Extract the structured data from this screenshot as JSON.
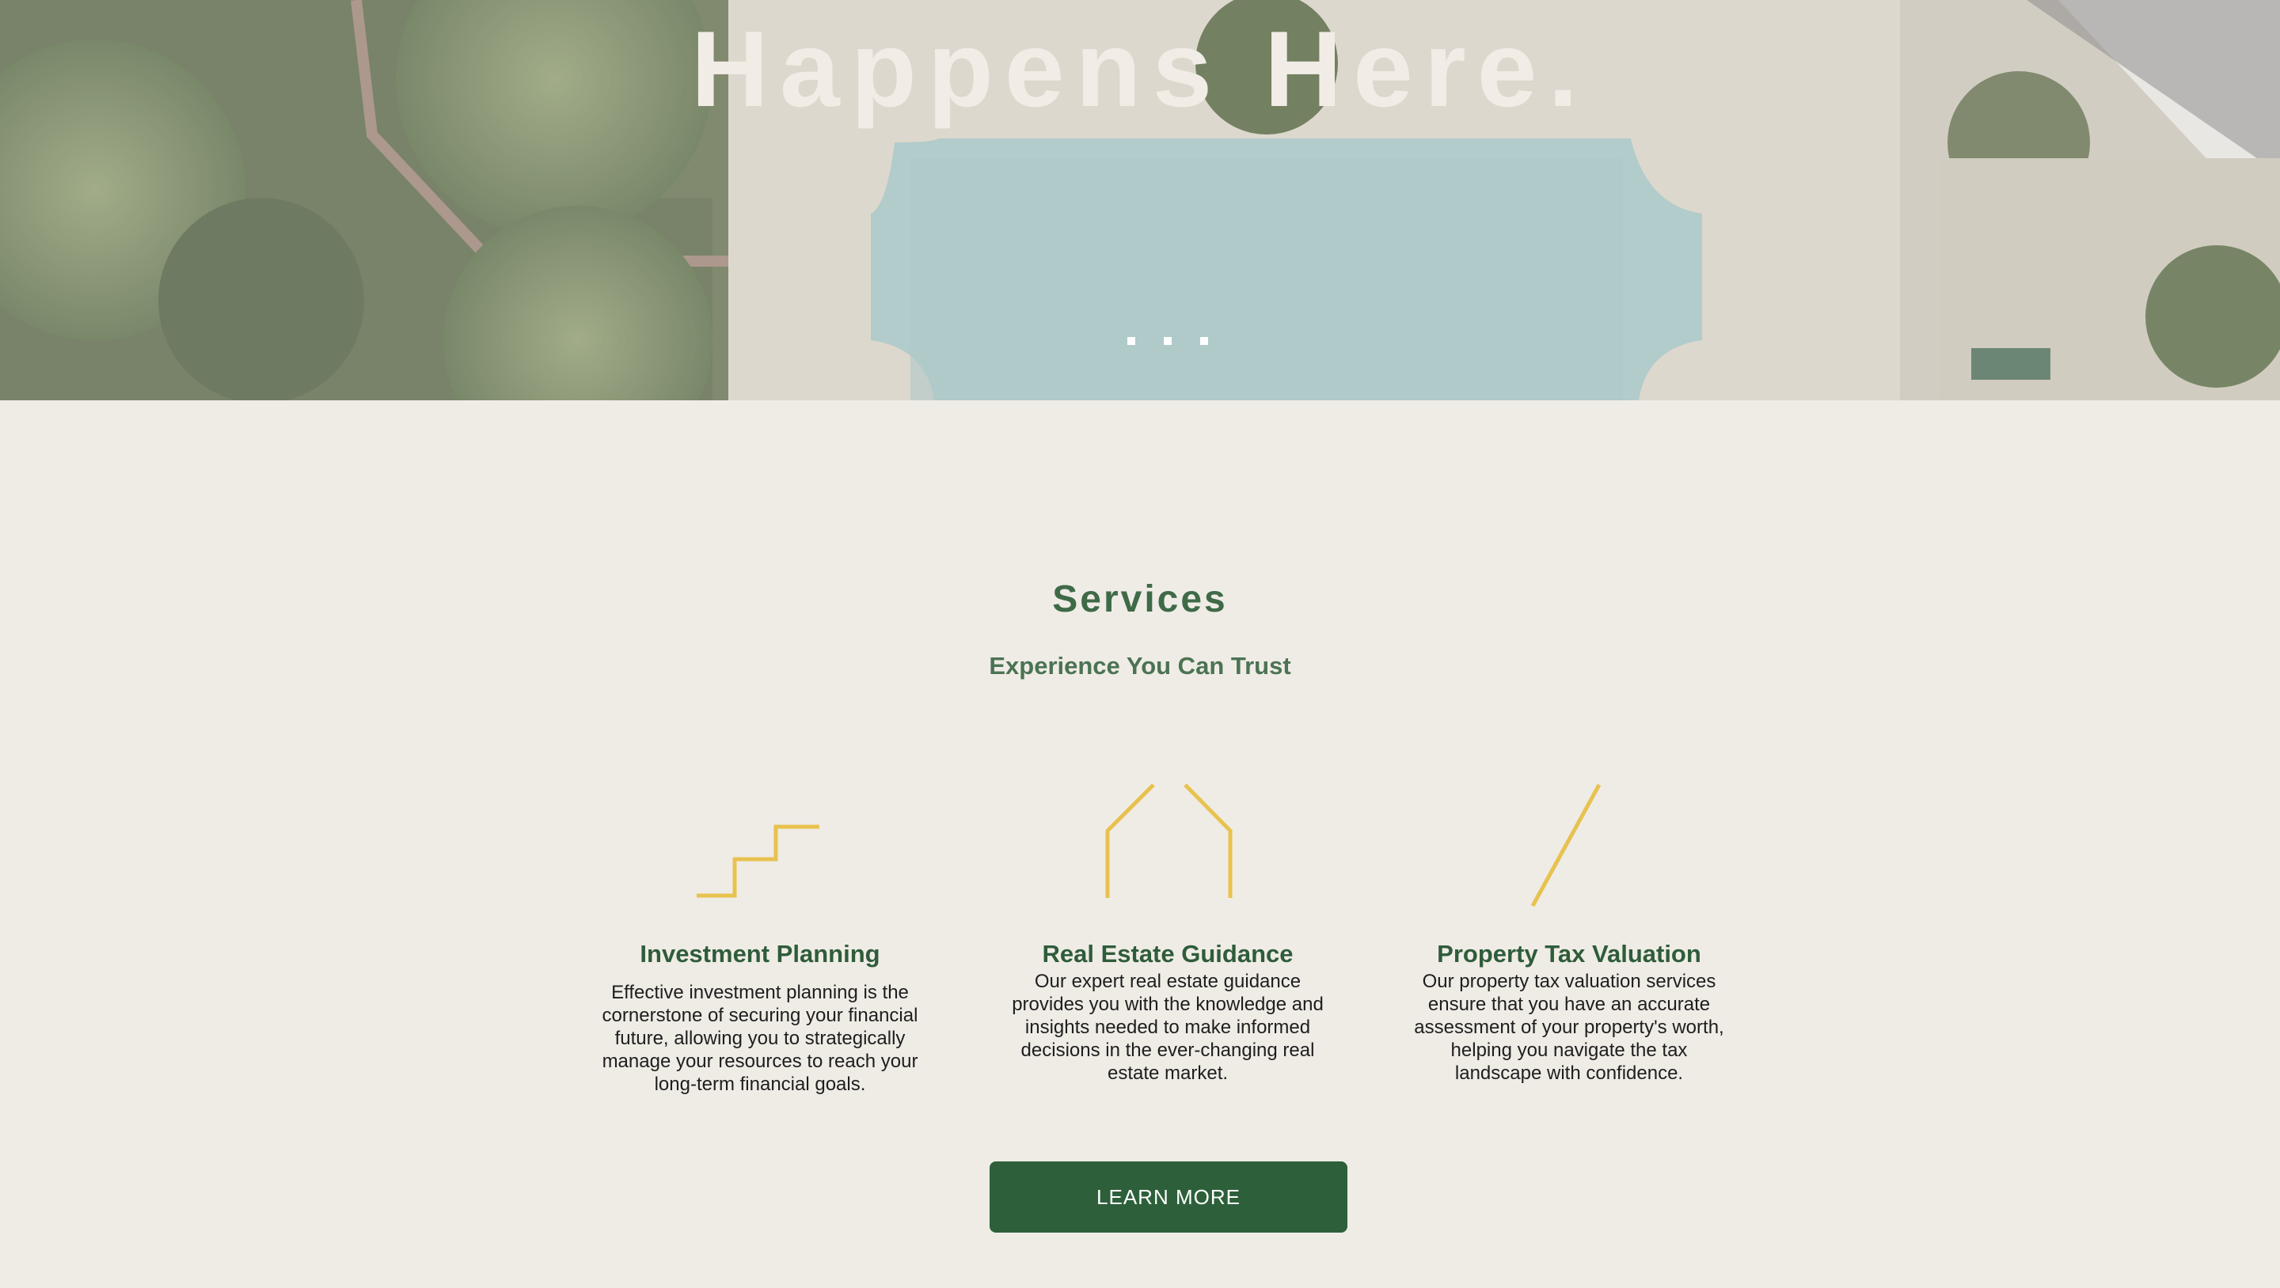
{
  "hero": {
    "title": "Happens Here.",
    "image_description_icon": "pool-aerial-photo",
    "slider_dots": 3
  },
  "services": {
    "title": "Services",
    "subtitle": "Experience You Can Trust",
    "items": [
      {
        "icon": "stairs-icon",
        "title": "Investment Planning",
        "description": "Effective investment planning is the cornerstone of securing your financial future, allowing you to strategically manage your resources to reach your long-term financial goals."
      },
      {
        "icon": "house-outline-icon",
        "title": "Real Estate Guidance",
        "description": "Our expert real estate guidance provides you with the knowledge and insights needed to make informed decisions in the ever-changing real estate market."
      },
      {
        "icon": "slash-icon",
        "title": "Property Tax Valuation",
        "description": "Our property tax valuation services ensure that you have an accurate assessment of your property's worth, helping you navigate the tax landscape with confidence."
      }
    ],
    "button_label": "LEARN MORE"
  },
  "colors": {
    "background": "#efece6",
    "brand_green": "#2d603a",
    "icon_gold": "#e8c24f",
    "hero_text": "#f1ede6"
  }
}
